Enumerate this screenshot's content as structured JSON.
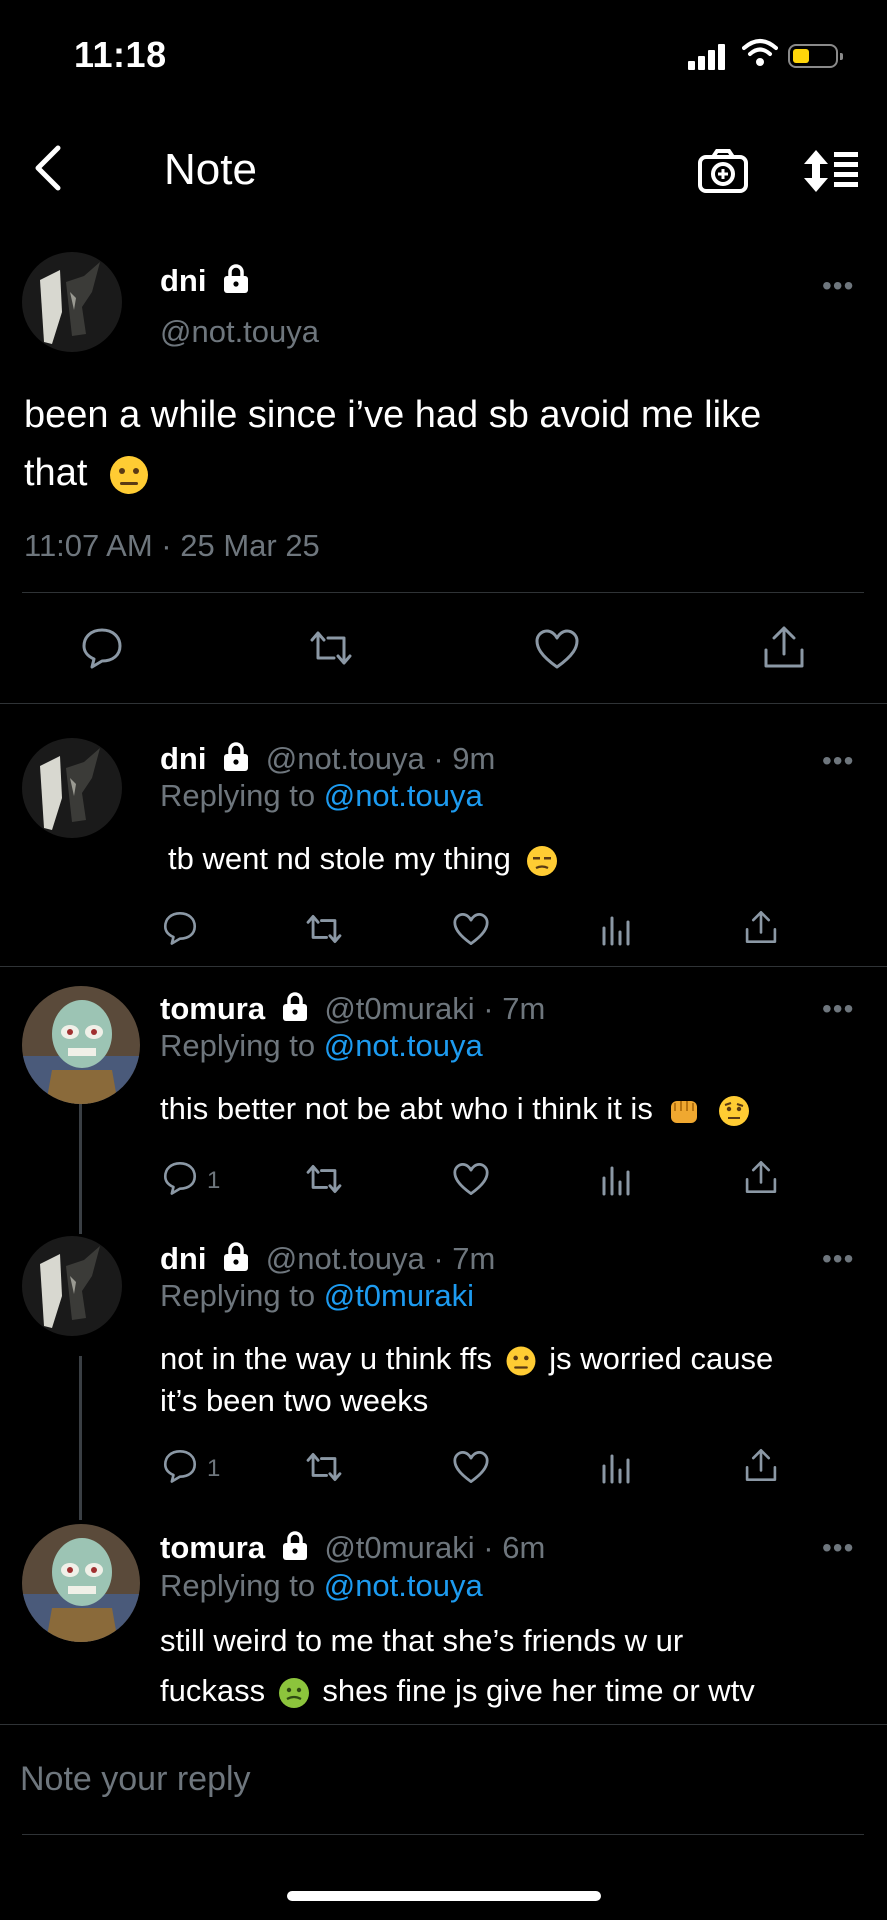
{
  "status_bar": {
    "time": "11:18"
  },
  "nav": {
    "title": "Note"
  },
  "main_post": {
    "name": "dni",
    "handle": "@not.touya",
    "text_1": "been a while since i’ve had sb avoid me like",
    "text_2": "that",
    "timestamp": "11:07 AM · 25 Mar 25"
  },
  "replies": [
    {
      "name": "dni",
      "handle": "@not.touya · 9m",
      "replying_prefix": "Replying to",
      "replying_to": "@not.touya",
      "text": "tb went nd stole my thing",
      "reply_count": ""
    },
    {
      "name": "tomura",
      "handle": "@t0muraki · 7m",
      "replying_prefix": "Replying to",
      "replying_to": "@not.touya",
      "text": "this better not be abt who i think it is",
      "reply_count": "1"
    },
    {
      "name": "dni",
      "handle": "@not.touya · 7m",
      "replying_prefix": "Replying to",
      "replying_to": "@t0muraki",
      "text_1": "not in the way u think ffs",
      "text_1b": "js worried cause",
      "text_2": "it’s been two weeks",
      "reply_count": "1"
    },
    {
      "name": "tomura",
      "handle": "@t0muraki · 6m",
      "replying_prefix": "Replying to",
      "replying_to": "@not.touya",
      "text_1": "still weird to me that she’s friends w ur",
      "text_2a": "fuckass",
      "text_2b": "shes fine js give her time or wtv"
    }
  ],
  "composer": {
    "placeholder": "Note your reply"
  },
  "colors": {
    "accent": "#1d9bf0",
    "muted": "#6e767d",
    "divider": "#2f3336",
    "battery": "#ffd60a"
  },
  "icons": [
    "back-arrow-icon",
    "camera-plus-icon",
    "sort-icon",
    "lock-icon",
    "more-icon",
    "comment-icon",
    "renote-icon",
    "like-icon",
    "share-icon",
    "stats-icon"
  ]
}
